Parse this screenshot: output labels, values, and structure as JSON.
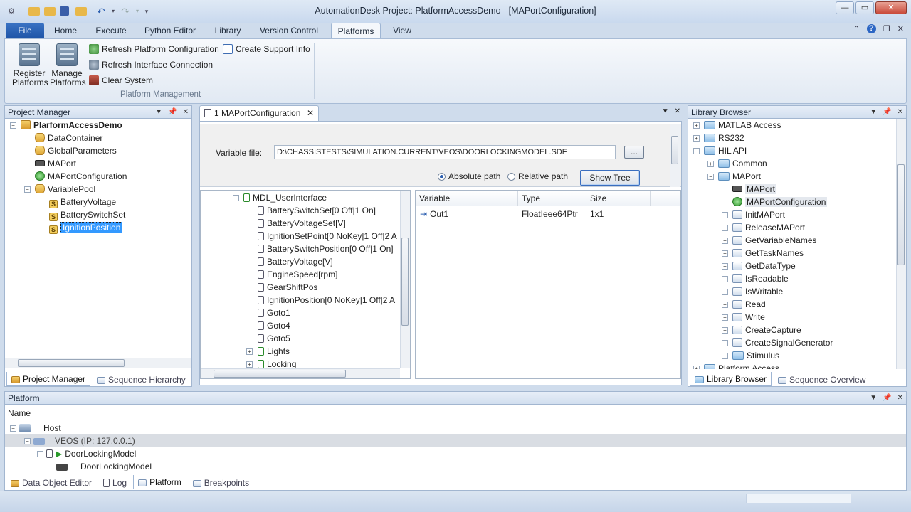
{
  "window": {
    "title": "AutomationDesk  Project: PlatformAccessDemo - [MAPortConfiguration]",
    "controls": {
      "minimize": "—",
      "maximize": "▭",
      "close": "✕"
    }
  },
  "ribbon": {
    "tabs": [
      "File",
      "Home",
      "Execute",
      "Python Editor",
      "Library",
      "Version Control",
      "Platforms",
      "View"
    ],
    "active_tab": "Platforms",
    "right_icons": {
      "minimize": "⌃",
      "help": "?",
      "restore": "❐",
      "close": "✕"
    },
    "register_label_1": "Register",
    "register_label_2": "Platforms",
    "manage_label_1": "Manage",
    "manage_label_2": "Platforms",
    "refresh_platform": "Refresh Platform Configuration",
    "create_support": "Create Support Info",
    "refresh_interface": "Refresh Interface Connection",
    "clear_system": "Clear System",
    "group_label": "Platform Management"
  },
  "project_manager": {
    "title": "Project Manager",
    "items": [
      {
        "label": "PlarformAccessDemo",
        "icon": "project-icon"
      },
      {
        "label": "DataContainer",
        "icon": "database-icon"
      },
      {
        "label": "GlobalParameters",
        "icon": "database-icon"
      },
      {
        "label": "MAPort",
        "icon": "port-icon"
      },
      {
        "label": "MAPortConfiguration",
        "icon": "config-icon"
      },
      {
        "label": "VariablePool",
        "icon": "database-icon"
      },
      {
        "label": "BatteryVoltage",
        "icon": "variable-icon"
      },
      {
        "label": "BatterySwitchSet",
        "icon": "variable-icon"
      },
      {
        "label": "IgnitionPosition",
        "icon": "variable-icon"
      }
    ],
    "tabs": [
      "Project Manager",
      "Sequence Hierarchy"
    ]
  },
  "document": {
    "tab_label": "1 MAPortConfiguration",
    "variable_file_label": "Variable file:",
    "variable_file_value": "D:\\CHASSISTESTS\\SIMULATION.CURRENT\\VEOS\\DOORLOCKINGMODEL.SDF",
    "browse_label": "...",
    "absolute_label": "Absolute path",
    "relative_label": "Relative path",
    "show_tree_label": "Show Tree",
    "tree_root": "MDL_UserInterface",
    "tree_items": [
      "BatterySwitchSet[0 Off|1 On]",
      "BatteryVoltageSet[V]",
      "IgnitionSetPoint[0 NoKey|1 Off|2 A",
      "BatterySwitchPosition[0 Off|1 On]",
      "BatteryVoltage[V]",
      "EngineSpeed[rpm]",
      "GearShiftPos",
      "IgnitionPosition[0 NoKey|1 Off|2 A",
      "Goto1",
      "Goto4",
      "Goto5"
    ],
    "tree_groups": [
      "Lights",
      "Locking"
    ],
    "table_headers": [
      "Variable",
      "Type",
      "Size"
    ],
    "table_rows": [
      {
        "variable": "Out1",
        "type": "FloatIeee64Ptr",
        "size": "1x1"
      }
    ]
  },
  "library_browser": {
    "title": "Library Browser",
    "items": [
      "MATLAB Access",
      "RS232",
      "HIL API",
      "Common",
      "MAPort",
      "MAPort",
      "MAPortConfiguration",
      "InitMAPort",
      "ReleaseMAPort",
      "GetVariableNames",
      "GetTaskNames",
      "GetDataType",
      "IsReadable",
      "IsWritable",
      "Read",
      "Write",
      "CreateCapture",
      "CreateSignalGenerator",
      "Stimulus",
      "Platform Access"
    ],
    "tabs": [
      "Library Browser",
      "Sequence Overview"
    ]
  },
  "platform": {
    "title": "Platform",
    "column_header": "Name",
    "items": [
      "Host",
      "VEOS (IP: 127.0.0.1)",
      "DoorLockingModel",
      "DoorLockingModel"
    ],
    "tabs": [
      "Data Object Editor",
      "Log",
      "Platform",
      "Breakpoints"
    ]
  },
  "colors": {
    "accent": "#3399ff",
    "file_tab": "#1f55a7",
    "panel_border": "#a2b6d0"
  }
}
